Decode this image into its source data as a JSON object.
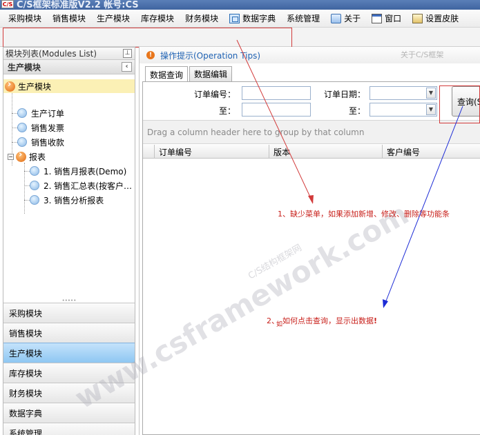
{
  "window": {
    "title": "C/S框架标准版V2.2  帐号:CS",
    "logo_text": "C/S"
  },
  "menubar": {
    "items": [
      {
        "label": "采购模块",
        "icon": ""
      },
      {
        "label": "销售模块",
        "icon": ""
      },
      {
        "label": "生产模块",
        "icon": ""
      },
      {
        "label": "库存模块",
        "icon": ""
      },
      {
        "label": "财务模块",
        "icon": ""
      },
      {
        "label": "数据字典",
        "icon": "dictionary-icon"
      },
      {
        "label": "系统管理",
        "icon": ""
      },
      {
        "label": "关于",
        "icon": "about-icon"
      },
      {
        "label": "窗口",
        "icon": "window-icon"
      },
      {
        "label": "设置皮肤",
        "icon": "skin-icon"
      }
    ]
  },
  "left_panel": {
    "header": "模块列表(Modules List)",
    "pin_glyph": "⊥",
    "group_title": "生产模块",
    "collapse_glyph": "‹",
    "tree": {
      "root": "生产模块",
      "items": [
        "生产订单",
        "销售发票",
        "销售收款"
      ],
      "report_group": "报表",
      "expander": "−",
      "reports": [
        "1. 销售月报表(Demo)",
        "2. 销售汇总表(按客户…",
        "3. 销售分析报表"
      ]
    },
    "splitter": "•••••",
    "nav_items": [
      "采购模块",
      "销售模块",
      "生产模块",
      "库存模块",
      "财务模块",
      "数据字典",
      "系统管理"
    ],
    "active_nav": "生产模块"
  },
  "right_panel": {
    "operation_tips": "操作提示(Operation Tips)",
    "about_link": "关于C/S框架",
    "tabs": [
      {
        "label": "数据查询",
        "active": true
      },
      {
        "label": "数据编辑",
        "active": false
      }
    ],
    "search": {
      "order_no_label": "订单编号：",
      "order_no_to_label": "至：",
      "order_date_label": "订单日期：",
      "order_date_to_label": "至：",
      "order_no_from": "",
      "order_no_to": "",
      "order_date_from": "",
      "order_date_to": "",
      "dropdown_glyph": "▼",
      "query_button": "查询(S"
    },
    "grid": {
      "group_hint": "Drag a column header here to group by that column",
      "columns": [
        "订单编号",
        "版本",
        "客户编号"
      ]
    }
  },
  "watermark": {
    "main": "www.csframework.com",
    "sub": "C/S结构框架网"
  },
  "annotations": {
    "note1": "1、缺少菜单，如果添加新增、修改、删除等功能条",
    "note2_prefix": "2、",
    "note2_small": "如",
    "note2_text": "如何点击查询，显示出数据",
    "note2_mark": "!",
    "colors": {
      "red": "#d23a3a",
      "blue": "#1c2bd6"
    }
  }
}
